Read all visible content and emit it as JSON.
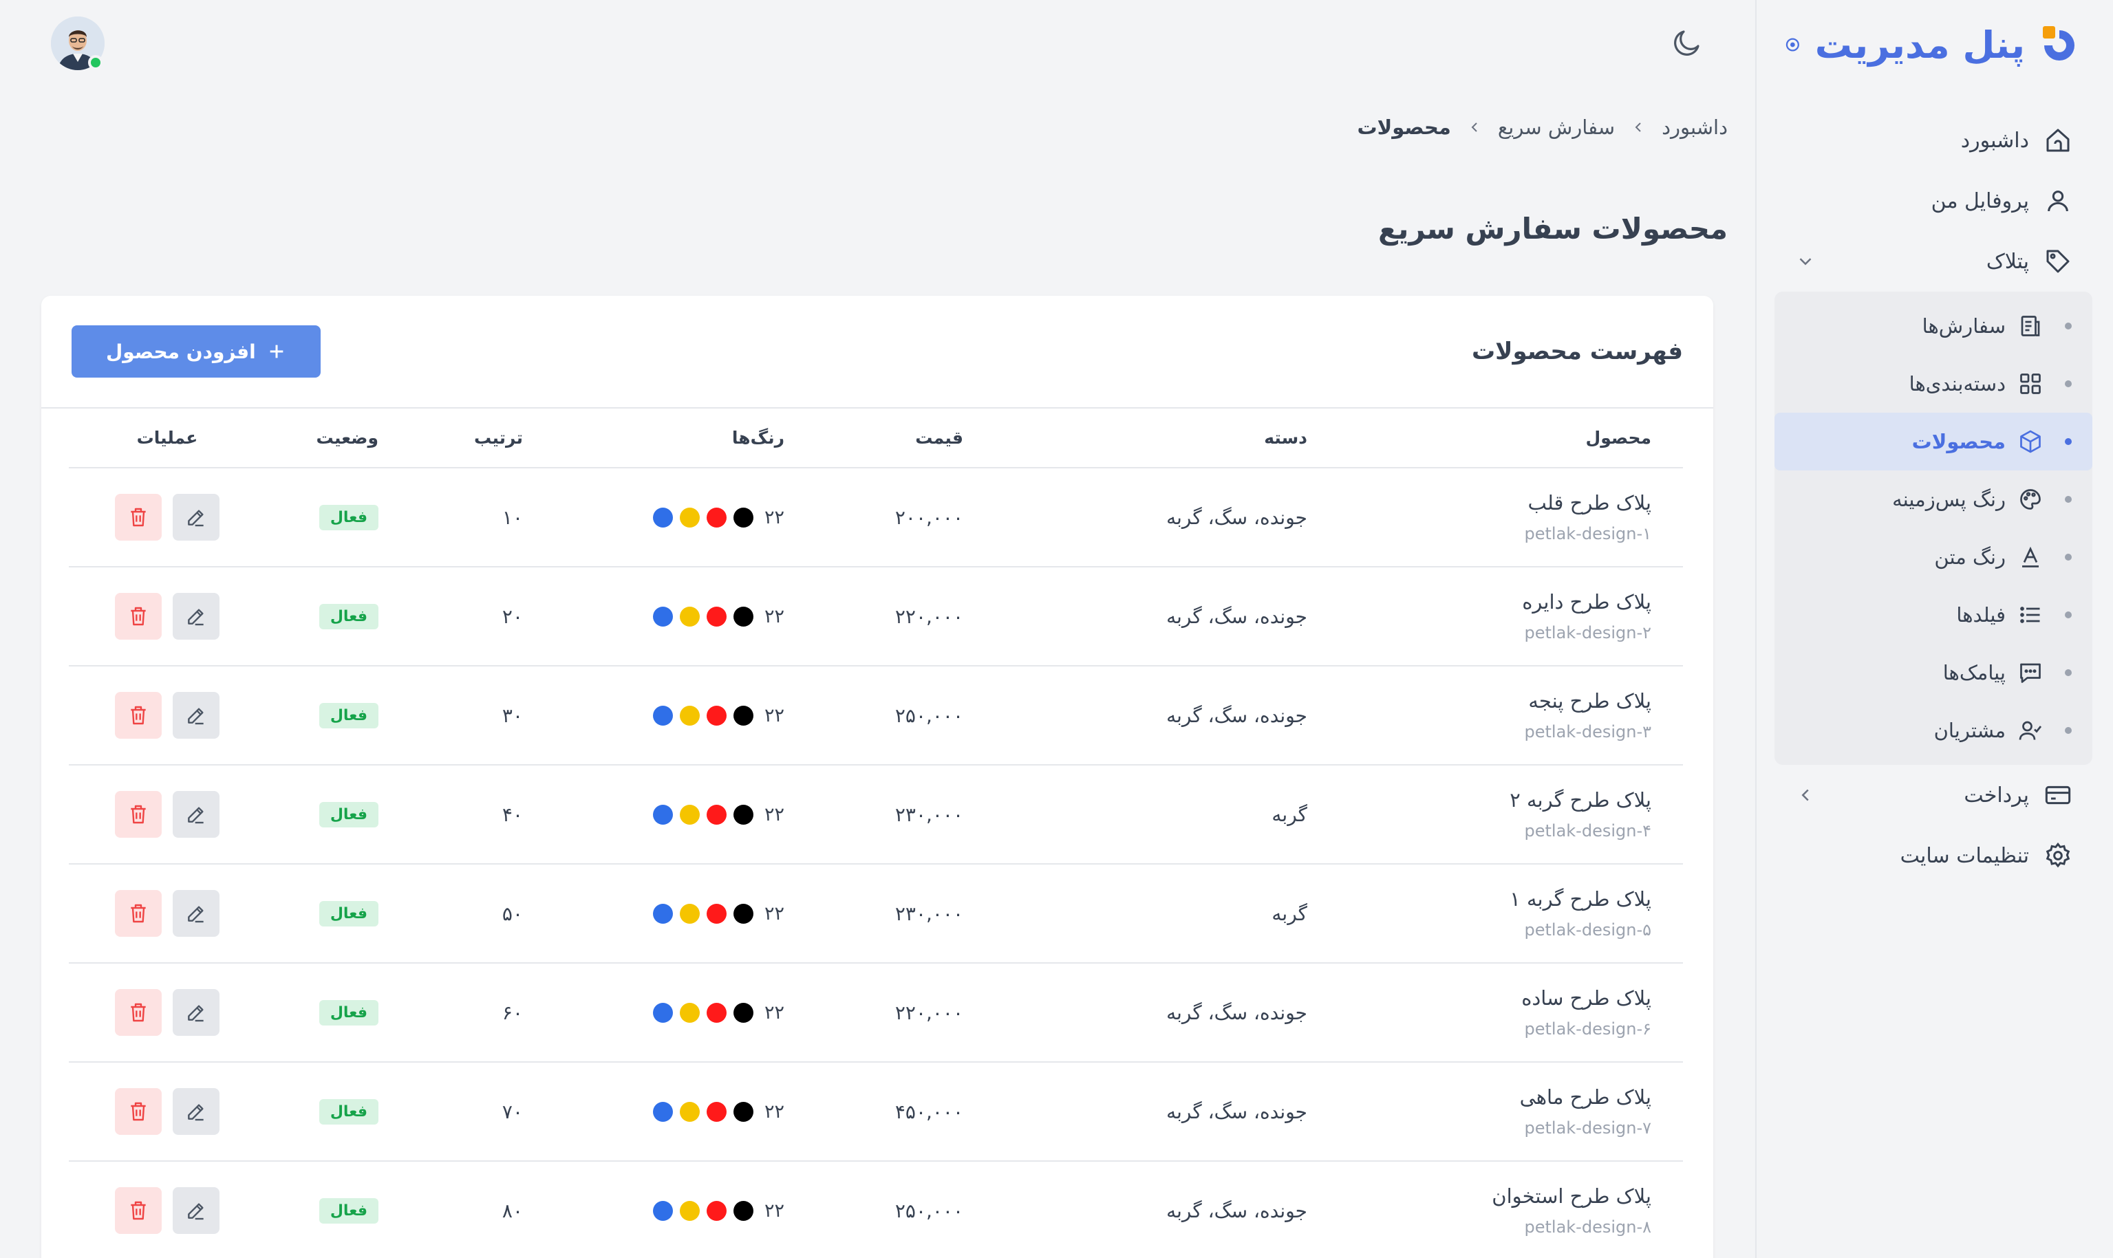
{
  "brand": {
    "title": "پنل مدیریت",
    "accent": "#4a6fe0",
    "logo_secondary": "#f59e0b"
  },
  "sidebar": {
    "items": [
      {
        "label": "داشبورد",
        "icon": "home-icon"
      },
      {
        "label": "پروفایل من",
        "icon": "user-icon"
      },
      {
        "label": "پتلاک",
        "icon": "tag-icon",
        "expanded": true
      }
    ],
    "submenu": [
      {
        "label": "سفارش‌ها",
        "icon": "orders-icon"
      },
      {
        "label": "دسته‌بندی‌ها",
        "icon": "grid-icon"
      },
      {
        "label": "محصولات",
        "icon": "box-icon",
        "active": true
      },
      {
        "label": "رنگ پس‌زمینه",
        "icon": "palette-icon"
      },
      {
        "label": "رنگ متن",
        "icon": "text-color-icon"
      },
      {
        "label": "فیلدها",
        "icon": "list-icon"
      },
      {
        "label": "پیامک‌ها",
        "icon": "message-icon"
      },
      {
        "label": "مشتریان",
        "icon": "customer-icon"
      }
    ],
    "bottom_items": [
      {
        "label": "پرداخت",
        "icon": "credit-card-icon"
      },
      {
        "label": "تنظیمات سایت",
        "icon": "gear-icon"
      }
    ]
  },
  "breadcrumb": {
    "home": "داشبورد",
    "section": "سفارش سریع",
    "current": "محصولات"
  },
  "page": {
    "title": "محصولات سفارش سریع"
  },
  "card": {
    "title": "فهرست محصولات",
    "add_button": "افزودن محصول"
  },
  "table": {
    "headers": {
      "product": "محصول",
      "category": "دسته",
      "price": "قیمت",
      "colors": "رنگ‌ها",
      "order": "ترتیب",
      "status": "وضعیت",
      "operations": "عملیات"
    },
    "swatch_colors": [
      "#000000",
      "#ff1a1a",
      "#f5c400",
      "#2f6fe8"
    ],
    "rows": [
      {
        "name": "پلاک طرح قلب",
        "slug": "petlak-design-۱",
        "category": "جونده، سگ، گربه",
        "price": "۲۰۰,۰۰۰",
        "colors_count": "۲۲",
        "order": "۱۰",
        "status": "فعال"
      },
      {
        "name": "پلاک طرح دایره",
        "slug": "petlak-design-۲",
        "category": "جونده، سگ، گربه",
        "price": "۲۲۰,۰۰۰",
        "colors_count": "۲۲",
        "order": "۲۰",
        "status": "فعال"
      },
      {
        "name": "پلاک طرح پنجه",
        "slug": "petlak-design-۳",
        "category": "جونده، سگ، گربه",
        "price": "۲۵۰,۰۰۰",
        "colors_count": "۲۲",
        "order": "۳۰",
        "status": "فعال"
      },
      {
        "name": "پلاک طرح گربه ۲",
        "slug": "petlak-design-۴",
        "category": "گربه",
        "price": "۲۳۰,۰۰۰",
        "colors_count": "۲۲",
        "order": "۴۰",
        "status": "فعال"
      },
      {
        "name": "پلاک طرح گربه ۱",
        "slug": "petlak-design-۵",
        "category": "گربه",
        "price": "۲۳۰,۰۰۰",
        "colors_count": "۲۲",
        "order": "۵۰",
        "status": "فعال"
      },
      {
        "name": "پلاک طرح ساده",
        "slug": "petlak-design-۶",
        "category": "جونده، سگ، گربه",
        "price": "۲۲۰,۰۰۰",
        "colors_count": "۲۲",
        "order": "۶۰",
        "status": "فعال"
      },
      {
        "name": "پلاک طرح ماهی",
        "slug": "petlak-design-۷",
        "category": "جونده، سگ، گربه",
        "price": "۴۵۰,۰۰۰",
        "colors_count": "۲۲",
        "order": "۷۰",
        "status": "فعال"
      },
      {
        "name": "پلاک طرح استخوان",
        "slug": "petlak-design-۸",
        "category": "جونده، سگ، گربه",
        "price": "۲۵۰,۰۰۰",
        "colors_count": "۲۲",
        "order": "۸۰",
        "status": "فعال"
      }
    ]
  },
  "theme": {
    "status_active_bg": "#d8f3e2",
    "status_active_text": "#16a34a",
    "delete_color": "#ef4444"
  }
}
